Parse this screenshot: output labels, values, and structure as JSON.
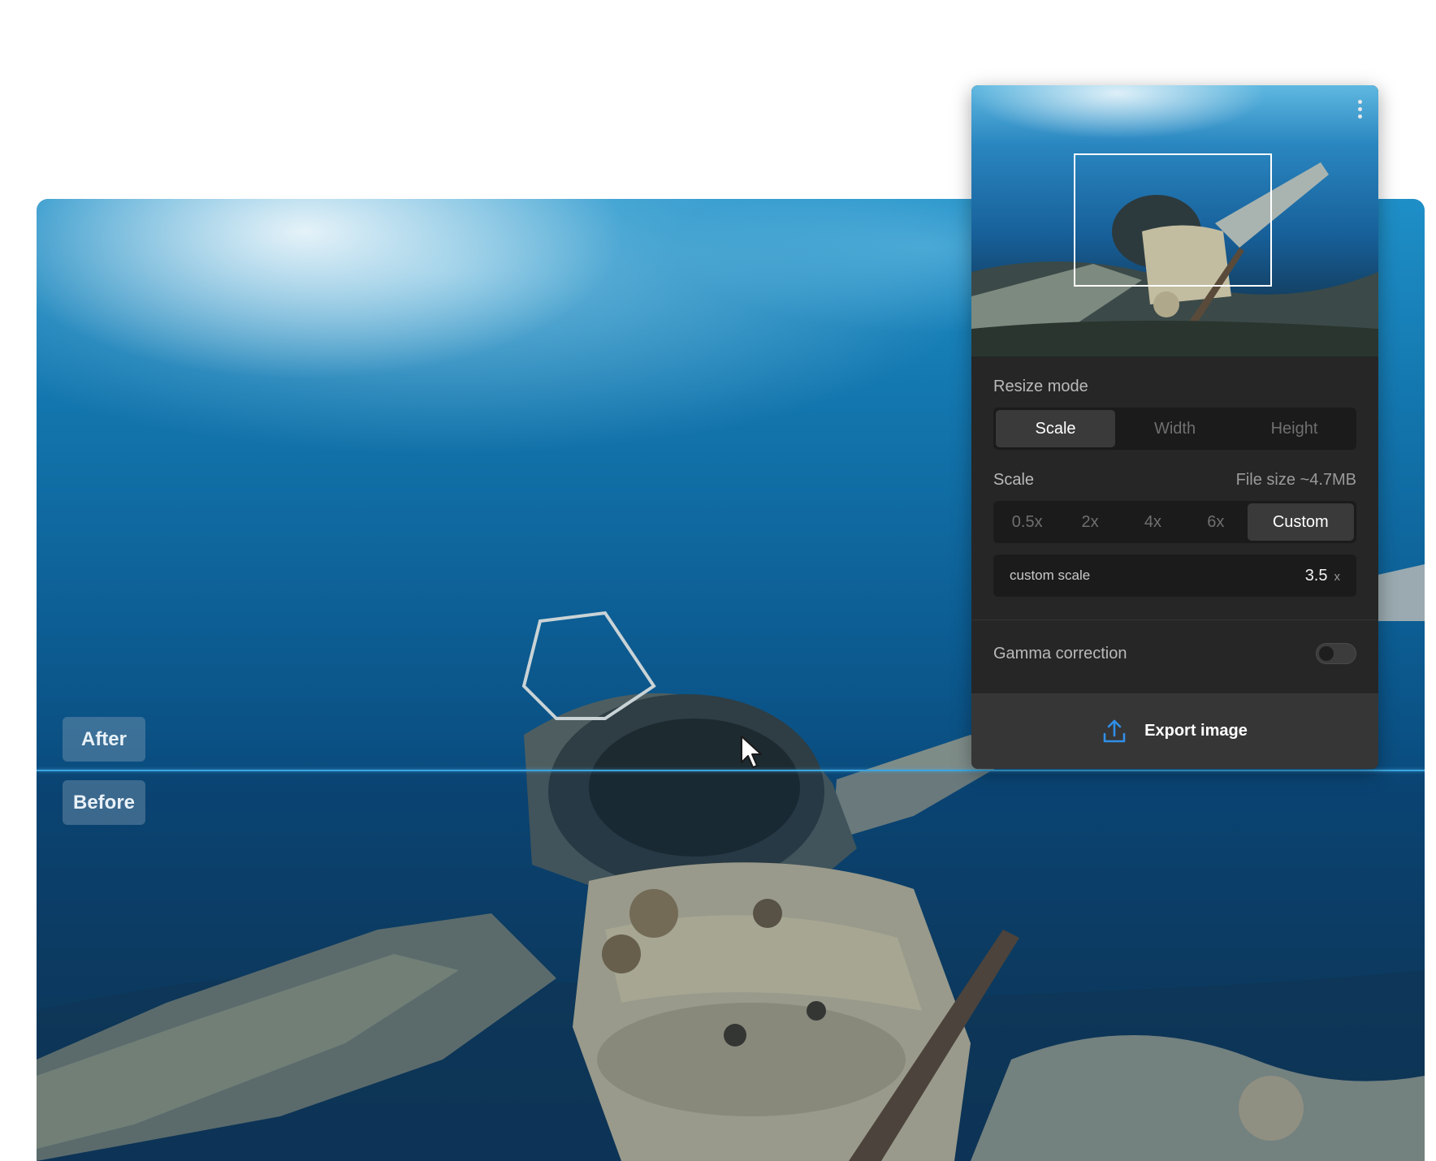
{
  "compare": {
    "after_label": "After",
    "before_label": "Before"
  },
  "panel": {
    "resize_mode": {
      "title": "Resize mode",
      "options": [
        "Scale",
        "Width",
        "Height"
      ],
      "selected": "Scale"
    },
    "scale": {
      "title": "Scale",
      "file_size": "File size ~4.7MB",
      "options": [
        "0.5x",
        "2x",
        "4x",
        "6x",
        "Custom"
      ],
      "selected": "Custom",
      "custom_label": "custom scale",
      "custom_value": "3.5",
      "custom_unit": "x"
    },
    "gamma": {
      "label": "Gamma correction",
      "enabled": false
    },
    "export_label": "Export image"
  },
  "colors": {
    "accent": "#2f8fe8",
    "panel_bg": "#262626",
    "divider": "#3aa6e0"
  },
  "icons": [
    "more-vertical-icon",
    "upload-icon",
    "mouse-pointer-icon"
  ]
}
